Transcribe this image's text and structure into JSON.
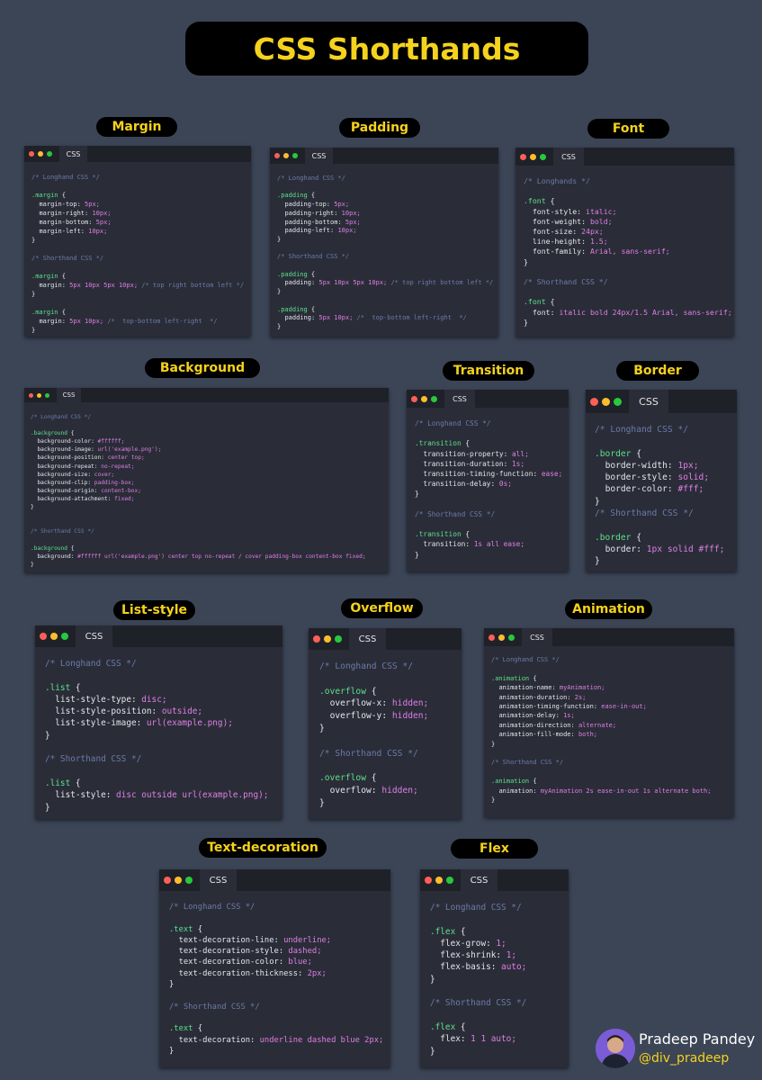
{
  "title": "CSS Shorthands",
  "tab_label": "CSS",
  "author": {
    "name": "Pradeep Pandey",
    "handle": "@div_pradeep"
  },
  "colors": {
    "background": "#3b4556",
    "accent": "#f5d21c",
    "window": "#2a2d38",
    "comment": "#6c7aa8",
    "selector": "#5ee08a",
    "value": "#e07ee6"
  },
  "cards": [
    {
      "label": "Margin",
      "lines": [
        "/* Longhand CSS */",
        "",
        ".margin {",
        "  margin-top: 5px;",
        "  margin-right: 10px;",
        "  margin-bottom: 5px;",
        "  margin-left: 10px;",
        "}",
        "",
        "/* Shorthand CSS */",
        "",
        ".margin {",
        "  margin: 5px 10px 5px 10px; /* top right bottom left */",
        "}",
        "",
        ".margin {",
        "  margin: 5px 10px; /*  top-bottom left-right  */",
        "}"
      ]
    },
    {
      "label": "Padding",
      "lines": [
        "/* Longhand CSS */",
        "",
        ".padding {",
        "  padding-top: 5px;",
        "  padding-right: 10px;",
        "  padding-bottom: 5px;",
        "  padding-left: 10px;",
        "}",
        "",
        "/* Shorthand CSS */",
        "",
        ".padding {",
        "  padding: 5px 10px 5px 10px; /* top right bottom left */",
        "}",
        "",
        ".padding {",
        "  padding: 5px 10px; /*  top-bottom left-right  */",
        "}"
      ]
    },
    {
      "label": "Font",
      "lines": [
        "/* Longhands */",
        "",
        ".font {",
        "  font-style: italic;",
        "  font-weight: bold;",
        "  font-size: 24px;",
        "  line-height: 1.5;",
        "  font-family: Arial, sans-serif;",
        "}",
        "",
        "/* Shorthand CSS */",
        "",
        ".font {",
        "  font: italic bold 24px/1.5 Arial, sans-serif;",
        "}"
      ]
    },
    {
      "label": "Background",
      "lines": [
        "/* Longhand CSS */",
        "",
        ".background {",
        "  background-color: #ffffff;",
        "  background-image: url('example.png');",
        "  background-position: center top;",
        "  background-repeat: no-repeat;",
        "  background-size: cover;",
        "  background-clip: padding-box;",
        "  background-origin: content-box;",
        "  background-attachment: fixed;",
        "}",
        "",
        "",
        "/* Shorthand CSS */",
        "",
        ".background {",
        "  background: #ffffff url('example.png') center top no-repeat / cover padding-box content-box fixed;",
        "}"
      ]
    },
    {
      "label": "Transition",
      "lines": [
        "/* Longhand CSS */",
        "",
        ".transition {",
        "  transition-property: all;",
        "  transition-duration: 1s;",
        "  transition-timing-function: ease;",
        "  transition-delay: 0s;",
        "}",
        "",
        "/* Shorthand CSS */",
        "",
        ".transition {",
        "  transition: 1s all ease;",
        "}"
      ]
    },
    {
      "label": "Border",
      "lines": [
        "/* Longhand CSS */",
        "",
        ".border {",
        "  border-width: 1px;",
        "  border-style: solid;",
        "  border-color: #fff;",
        "}",
        "/* Shorthand CSS */",
        "",
        ".border {",
        "  border: 1px solid #fff;",
        "}"
      ]
    },
    {
      "label": "List-style",
      "lines": [
        "/* Longhand CSS */",
        "",
        ".list {",
        "  list-style-type: disc;",
        "  list-style-position: outside;",
        "  list-style-image: url(example.png);",
        "}",
        "",
        "/* Shorthand CSS */",
        "",
        ".list {",
        "  list-style: disc outside url(example.png);",
        "}"
      ]
    },
    {
      "label": "Overflow",
      "lines": [
        "/* Longhand CSS */",
        "",
        ".overflow {",
        "  overflow-x: hidden;",
        "  overflow-y: hidden;",
        "}",
        "",
        "/* Shorthand CSS */",
        "",
        ".overflow {",
        "  overflow: hidden;",
        "}"
      ]
    },
    {
      "label": "Animation",
      "lines": [
        "/* Longhand CSS */",
        "",
        ".animation {",
        "  animation-name: myAnimation;",
        "  animation-duration: 2s;",
        "  animation-timing-function: ease-in-out;",
        "  animation-delay: 1s;",
        "  animation-direction: alternate;",
        "  animation-fill-mode: both;",
        "}",
        "",
        "/* Shorthand CSS */",
        "",
        ".animation {",
        "  animation: myAnimation 2s ease-in-out 1s alternate both;",
        "}"
      ]
    },
    {
      "label": "Text-decoration",
      "lines": [
        "/* Longhand CSS */",
        "",
        ".text {",
        "  text-decoration-line: underline;",
        "  text-decoration-style: dashed;",
        "  text-decoration-color: blue;",
        "  text-decoration-thickness: 2px;",
        "}",
        "",
        "/* Shorthand CSS */",
        "",
        ".text {",
        "  text-decoration: underline dashed blue 2px;",
        "}"
      ]
    },
    {
      "label": "Flex",
      "lines": [
        "/* Longhand CSS */",
        "",
        ".flex {",
        "  flex-grow: 1;",
        "  flex-shrink: 1;",
        "  flex-basis: auto;",
        "}",
        "",
        "/* Shorthand CSS */",
        "",
        ".flex {",
        "  flex: 1 1 auto;",
        "}"
      ]
    }
  ]
}
